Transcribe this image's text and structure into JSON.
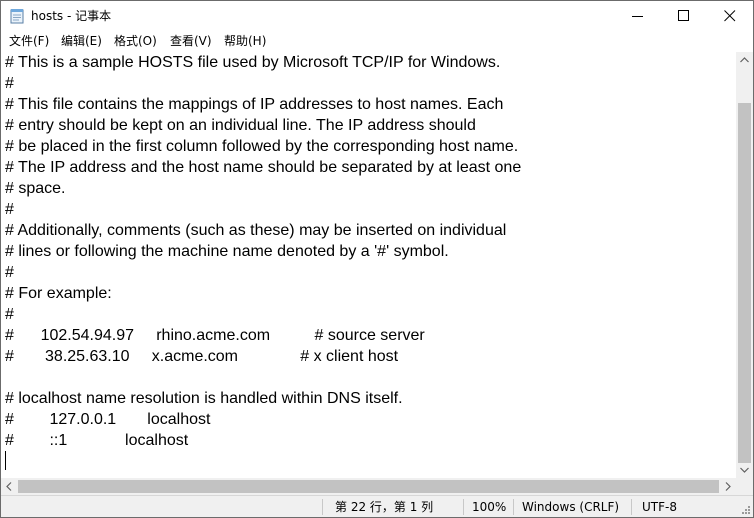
{
  "window": {
    "title": "hosts - 记事本"
  },
  "menu": {
    "items": [
      "文件(F)",
      "编辑(E)",
      "格式(O)",
      "查看(V)",
      "帮助(H)"
    ]
  },
  "editor": {
    "lines": [
      "# This is a sample HOSTS file used by Microsoft TCP/IP for Windows.",
      "#",
      "# This file contains the mappings of IP addresses to host names. Each",
      "# entry should be kept on an individual line. The IP address should",
      "# be placed in the first column followed by the corresponding host name.",
      "# The IP address and the host name should be separated by at least one",
      "# space.",
      "#",
      "# Additionally, comments (such as these) may be inserted on individual",
      "# lines or following the machine name denoted by a '#' symbol.",
      "#",
      "# For example:",
      "#",
      "#      102.54.94.97     rhino.acme.com          # source server",
      "#       38.25.63.10     x.acme.com              # x client host",
      "",
      "# localhost name resolution is handled within DNS itself.",
      "#\t127.0.0.1       localhost",
      "#\t::1             localhost",
      ""
    ]
  },
  "status": {
    "position": "第 22 行，第 1 列",
    "zoom": "100%",
    "line_ending": "Windows (CRLF)",
    "encoding": "UTF-8"
  },
  "colors": {
    "chrome": "#f0f0f0",
    "scroll_thumb": "#c2c2c2",
    "text": "#000000",
    "border": "#6b6b6b"
  },
  "icons": {
    "app": "notepad-icon",
    "minimize": "minimize-icon",
    "maximize": "maximize-icon",
    "close": "close-icon"
  }
}
